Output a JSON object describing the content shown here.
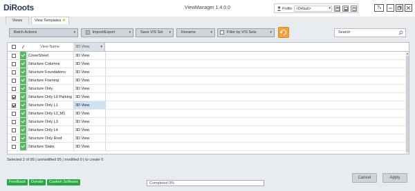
{
  "app": {
    "logo": "DiRoots",
    "title": "ViewManager 1.4.0.0"
  },
  "profile": {
    "label": "Profile",
    "selected": "<Default>"
  },
  "help": "?",
  "tabs": [
    {
      "label": "Views"
    },
    {
      "label": "View Templates"
    }
  ],
  "toolbar": {
    "batch_actions": "Batch Actions",
    "import_export": "Import/Export",
    "save_vs_set": "Save V/S Set",
    "rename": "Rename",
    "filter_by_vs_sets": "Filter by V/S Sets",
    "search_placeholder": "Search"
  },
  "grid": {
    "columns": [
      "View Name",
      "3D View"
    ],
    "rows": [
      {
        "name": "CoverSheet",
        "type": "3D View",
        "checked": false
      },
      {
        "name": "Structure Columns",
        "type": "3D View",
        "checked": false
      },
      {
        "name": "Structure Foundations",
        "type": "3D View",
        "checked": false
      },
      {
        "name": "Structure Framing",
        "type": "3D View",
        "checked": false
      },
      {
        "name": "Structure Only",
        "type": "3D View",
        "checked": false
      },
      {
        "name": "Structure Only L0 Parking",
        "type": "3D View",
        "checked": true
      },
      {
        "name": "Structure Only L1",
        "type": "3D View",
        "checked": true
      },
      {
        "name": "Structure Only L2_M1",
        "type": "3D View",
        "checked": false
      },
      {
        "name": "Structure Only L3",
        "type": "3D View",
        "checked": false
      },
      {
        "name": "Structure Only L4",
        "type": "3D View",
        "checked": false
      },
      {
        "name": "Structure Only Roof",
        "type": "3D View",
        "checked": false
      },
      {
        "name": "Structure Slabs",
        "type": "3D View",
        "checked": false
      }
    ]
  },
  "status": "Selected 2 of 95 | unmodified 95 | modified 0 | to create 0",
  "footer": {
    "feedback": "Feedback",
    "donate": "Donate",
    "custom_software": "Custom Software",
    "progress": "Completed 0%",
    "cancel": "Cancel",
    "apply": "Apply"
  },
  "colors": {
    "accent_green": "#5cb85c",
    "footer_green": "#28a745",
    "orange": "#f2a33a",
    "selected_cell": "#cfe2f3"
  }
}
